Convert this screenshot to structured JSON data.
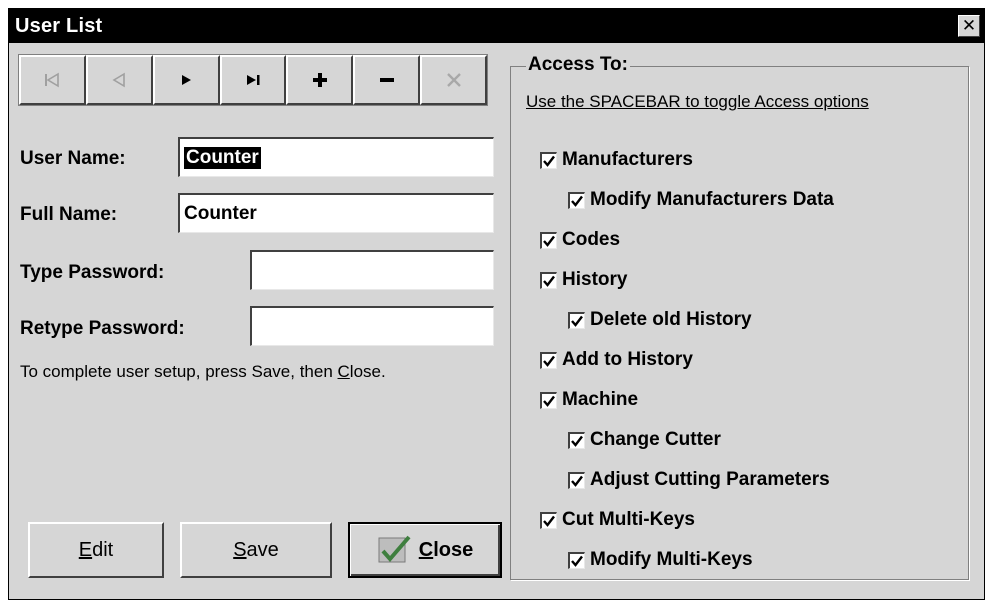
{
  "window": {
    "title": "User List",
    "close_glyph": "✕"
  },
  "nav": [
    {
      "name": "first-record-button",
      "icon": "first-icon",
      "enabled": false
    },
    {
      "name": "prev-record-button",
      "icon": "prev-icon",
      "enabled": false
    },
    {
      "name": "next-record-button",
      "icon": "next-icon",
      "enabled": true
    },
    {
      "name": "last-record-button",
      "icon": "last-icon",
      "enabled": true
    },
    {
      "name": "add-record-button",
      "icon": "plus-icon",
      "enabled": true
    },
    {
      "name": "delete-record-button",
      "icon": "minus-icon",
      "enabled": true
    },
    {
      "name": "cancel-record-button",
      "icon": "x-icon",
      "enabled": false
    }
  ],
  "form": {
    "user_name_label": "User Name:",
    "user_name_value": "Counter",
    "full_name_label": "Full Name:",
    "full_name_value": "Counter",
    "type_password_label": "Type Password:",
    "retype_password_label": "Retype Password:",
    "hint_before": "To complete user setup, press Save, then ",
    "hint_close_key": "C",
    "hint_close_rest": "lose."
  },
  "buttons": {
    "edit_key": "E",
    "edit_rest": "dit",
    "save_key": "S",
    "save_rest": "ave",
    "close_key": "C",
    "close_rest": "lose"
  },
  "access": {
    "legend": "Access To:",
    "hint": "Use the SPACEBAR to toggle Access options",
    "items": [
      {
        "label": "Manufacturers",
        "checked": true,
        "indent": 0
      },
      {
        "label": "Modify Manufacturers Data",
        "checked": true,
        "indent": 1
      },
      {
        "label": "Codes",
        "checked": true,
        "indent": 0
      },
      {
        "label": "History",
        "checked": true,
        "indent": 0
      },
      {
        "label": "Delete old History",
        "checked": true,
        "indent": 1
      },
      {
        "label": "Add to History",
        "checked": true,
        "indent": 0
      },
      {
        "label": "Machine",
        "checked": true,
        "indent": 0
      },
      {
        "label": "Change Cutter",
        "checked": true,
        "indent": 1
      },
      {
        "label": "Adjust Cutting Parameters",
        "checked": true,
        "indent": 1
      },
      {
        "label": "Cut Multi-Keys",
        "checked": true,
        "indent": 0
      },
      {
        "label": "Modify Multi-Keys",
        "checked": true,
        "indent": 1
      }
    ]
  }
}
